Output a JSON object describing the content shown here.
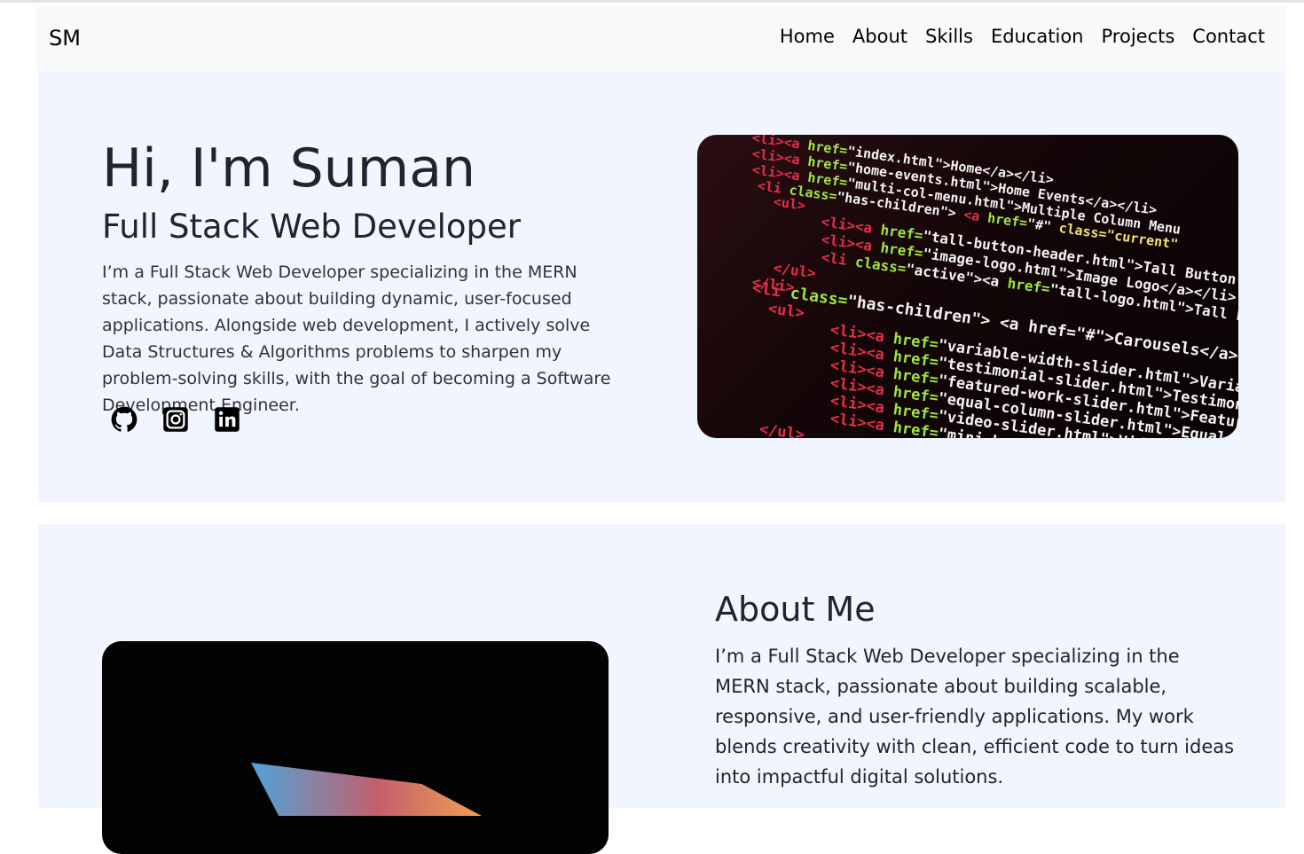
{
  "nav": {
    "brand": "SM",
    "links": [
      "Home",
      "About",
      "Skills",
      "Education",
      "Projects",
      "Contact"
    ]
  },
  "hero": {
    "title": "Hi, I'm Suman",
    "subtitle": "Full Stack Web Developer",
    "description": "I’m a Full Stack Web Developer specializing in the MERN stack, passionate about building dynamic, user-focused applications. Alongside web development, I actively solve Data Structures & Algorithms problems to sharpen my problem-solving skills, with the goal of becoming a Software Development Engineer.",
    "social_icons": [
      "github-icon",
      "instagram-icon",
      "linkedin-icon"
    ]
  },
  "about": {
    "title": "About Me",
    "text": "I’m a Full Stack Web Developer specializing in the MERN stack, passionate about building scalable, responsive, and user-friendly applications. My work blends creativity with clean, efficient code to turn ideas into impactful digital solutions."
  }
}
